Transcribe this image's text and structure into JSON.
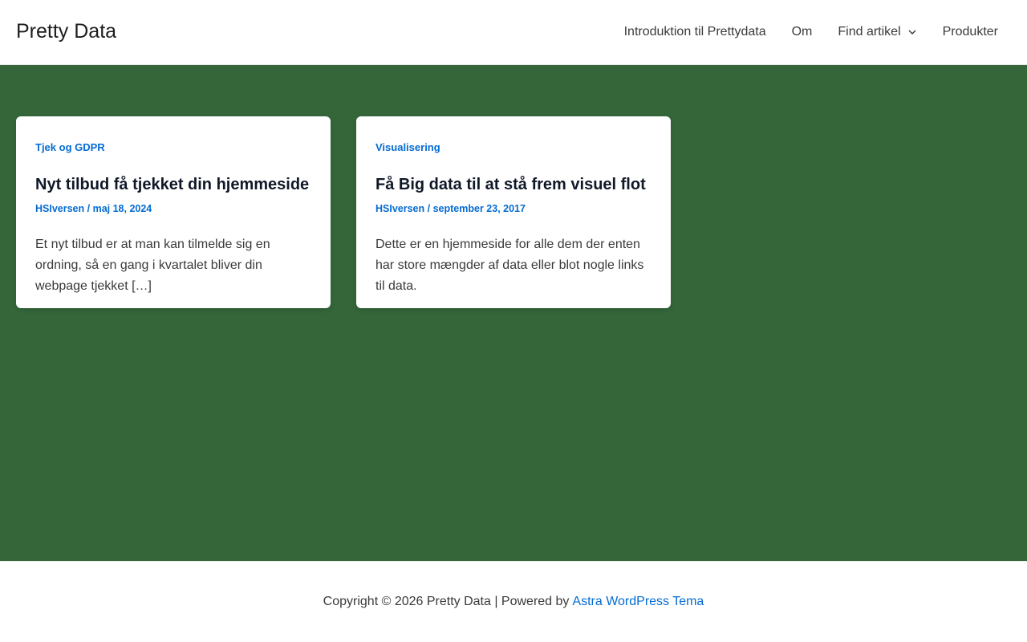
{
  "site": {
    "title": "Pretty Data"
  },
  "nav": {
    "items": [
      {
        "label": "Introduktion til Prettydata"
      },
      {
        "label": "Om"
      },
      {
        "label": "Find artikel",
        "has_dropdown": true
      },
      {
        "label": "Produkter"
      }
    ]
  },
  "colors": {
    "content_background": "#34663a",
    "accent": "#046bd2",
    "title_text": "#101828"
  },
  "posts": [
    {
      "category": "Tjek og GDPR",
      "title": "Nyt tilbud få tjekket din hjemmeside",
      "author": "HSIversen",
      "separator": "/",
      "date": "maj 18, 2024",
      "excerpt": "Et nyt tilbud er at man kan tilmelde sig en ordning, så en gang i kvartalet bliver din webpage tjekket […]"
    },
    {
      "category": "Visualisering",
      "title": "Få Big data til at stå frem visuel flot",
      "author": "HSIversen",
      "separator": "/",
      "date": "september 23, 2017",
      "excerpt": "Dette er en hjemmeside for alle dem der enten har store mængder af data eller blot nogle links til data."
    }
  ],
  "footer": {
    "copyright": "Copyright © 2026 Pretty Data | Powered by",
    "link_label": "Astra WordPress Tema"
  }
}
